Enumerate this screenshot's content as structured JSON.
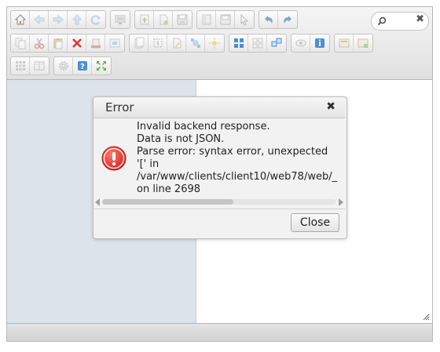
{
  "toolbar": {
    "row1": [
      [
        "home-icon",
        "back-icon",
        "forward-icon",
        "up-icon",
        "reload-icon"
      ],
      [
        "netmount-icon"
      ],
      [
        "upload-icon",
        "mkfile-icon",
        "save-icon"
      ],
      [
        "open-icon",
        "download-icon",
        "select-icon"
      ],
      [
        "undo-icon",
        "redo-icon"
      ]
    ],
    "row2": [
      [
        "copy-icon",
        "cut-icon",
        "paste-icon",
        "delete-icon",
        "empty-icon",
        "hide-icon"
      ],
      [
        "duplicate-icon",
        "rename-icon",
        "edit-icon",
        "resize-icon",
        "extract-icon"
      ],
      [
        "view-icons-icon",
        "view-list-icon",
        "view-tree-icon"
      ],
      [
        "quicklook-icon",
        "info-icon"
      ],
      [
        "chmod-icon",
        "archive-icon"
      ]
    ],
    "row3": [
      [
        "select-all-icon",
        "sort-icon"
      ],
      [
        "preferences-icon",
        "help-icon",
        "fullscreen-icon"
      ]
    ]
  },
  "search": {
    "value": "",
    "clear_label": "✖"
  },
  "dialog": {
    "title": "Error",
    "close_glyph": "✖",
    "messages": [
      "Invalid backend response.",
      "Data is not JSON.",
      "Parse error: syntax error, unexpected",
      "'[' in",
      "/var/www/clients/client10/web78/web/_",
      "on line 2698"
    ],
    "scroll_fraction": 0.56,
    "close_button": "Close"
  },
  "colors": {
    "accent": "#4a8fd6",
    "error_red": "#e0322c",
    "nav_bg": "#dde3ea"
  }
}
